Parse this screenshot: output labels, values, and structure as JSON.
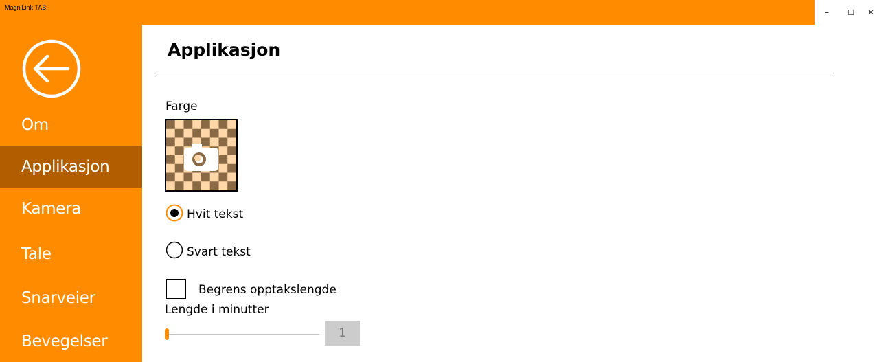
{
  "window": {
    "title": "MagniLink TAB",
    "minimize_glyph": "–",
    "maximize_glyph": "☐",
    "close_glyph": "✕"
  },
  "colors": {
    "accent": "#ff8c00",
    "active_nav": "#b05e00",
    "checker_light": "#ffd7a8",
    "checker_dark": "#8a6a44"
  },
  "sidebar": {
    "back_icon": "back-arrow-circle-icon",
    "items": [
      {
        "label": "Om",
        "active": false
      },
      {
        "label": "Applikasjon",
        "active": true
      },
      {
        "label": "Kamera",
        "active": false
      },
      {
        "label": "Tale",
        "active": false
      },
      {
        "label": "Snarveier",
        "active": false
      },
      {
        "label": "Bevegelser",
        "active": false
      }
    ]
  },
  "main": {
    "title": "Applikasjon",
    "color_label": "Farge",
    "color_swatch_icon": "camera-icon",
    "text_options": [
      {
        "label": "Hvit tekst",
        "selected": true
      },
      {
        "label": "Svart tekst",
        "selected": false
      }
    ],
    "limit_checkbox": {
      "label": "Begrens opptakslengde",
      "checked": false
    },
    "length_label": "Lengde i minutter",
    "length_value": "1",
    "length_slider_level": 0
  }
}
